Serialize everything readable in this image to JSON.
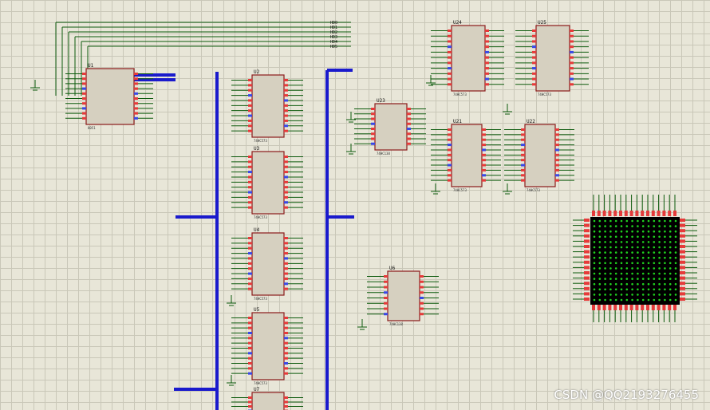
{
  "chips": [
    {
      "ref": "U1",
      "part": "8051"
    },
    {
      "ref": "U2",
      "part": "74HC573"
    },
    {
      "ref": "U3",
      "part": "74HC573"
    },
    {
      "ref": "U4",
      "part": "74HC573"
    },
    {
      "ref": "U5",
      "part": "74HC573"
    },
    {
      "ref": "U6",
      "part": "74HC138"
    },
    {
      "ref": "U7",
      "part": "74HC573"
    },
    {
      "ref": "U21",
      "part": "74HC573"
    },
    {
      "ref": "U22",
      "part": "74HC573"
    },
    {
      "ref": "U23",
      "part": "74HC138"
    },
    {
      "ref": "U24",
      "part": "74HC573"
    },
    {
      "ref": "U25",
      "part": "74HC573"
    }
  ],
  "top_nets": [
    "HD0",
    "HD1",
    "HD2",
    "HD3",
    "HD4",
    "HD5"
  ],
  "watermark": "CSDN @QQ2193276455",
  "colors": {
    "background": "#e8e6d8",
    "wire": "#0c5a0c",
    "bus": "#1a1acc",
    "chip_border": "#8b1a1a",
    "led_on": "#1fd11f",
    "matrix_bg": "#000000"
  }
}
